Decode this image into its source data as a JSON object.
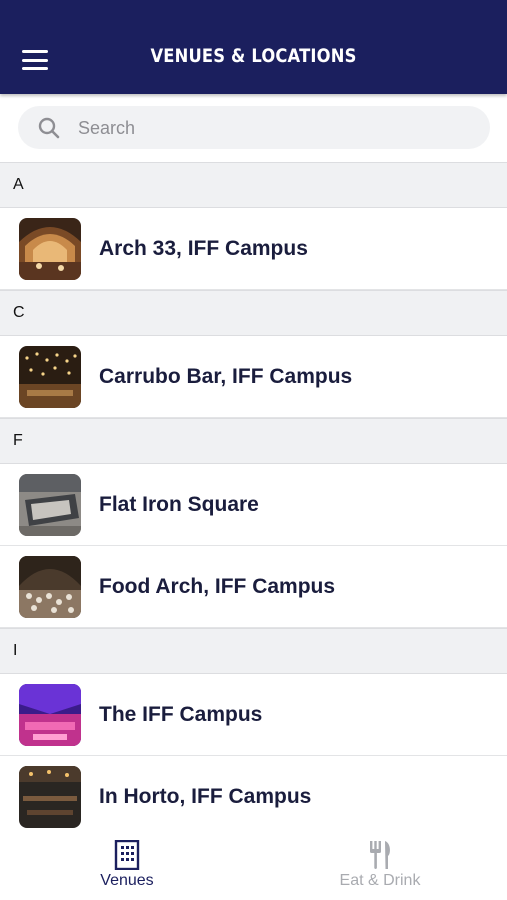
{
  "header": {
    "title": "VENUES & LOCATIONS",
    "menu_icon": "hamburger-menu-icon",
    "background": "#1b1f5e"
  },
  "search": {
    "placeholder": "Search",
    "value": "",
    "icon": "search-icon"
  },
  "sections": [
    {
      "letter": "A",
      "items": [
        {
          "label": "Arch 33, IFF Campus",
          "thumb_theme": "warm-arched-hall"
        }
      ]
    },
    {
      "letter": "C",
      "items": [
        {
          "label": "Carrubo Bar, IFF Campus",
          "thumb_theme": "string-lights-bar"
        }
      ]
    },
    {
      "letter": "F",
      "items": [
        {
          "label": "Flat Iron Square",
          "thumb_theme": "outdoor-square"
        },
        {
          "label": "Food Arch, IFF Campus",
          "thumb_theme": "crowded-food-hall"
        }
      ]
    },
    {
      "letter": "I",
      "items": [
        {
          "label": "The IFF Campus",
          "thumb_theme": "purple-lit-venue"
        },
        {
          "label": "In Horto, IFF Campus",
          "thumb_theme": "dark-dining-room"
        }
      ]
    }
  ],
  "tabbar": {
    "tabs": [
      {
        "label": "Venues",
        "icon": "building-icon",
        "active": true
      },
      {
        "label": "Eat & Drink",
        "icon": "fork-knife-icon",
        "active": false
      }
    ]
  },
  "colors": {
    "accent": "#1b1f5e",
    "inactive": "#a9abb0",
    "section_bg": "#f0f1f3"
  }
}
